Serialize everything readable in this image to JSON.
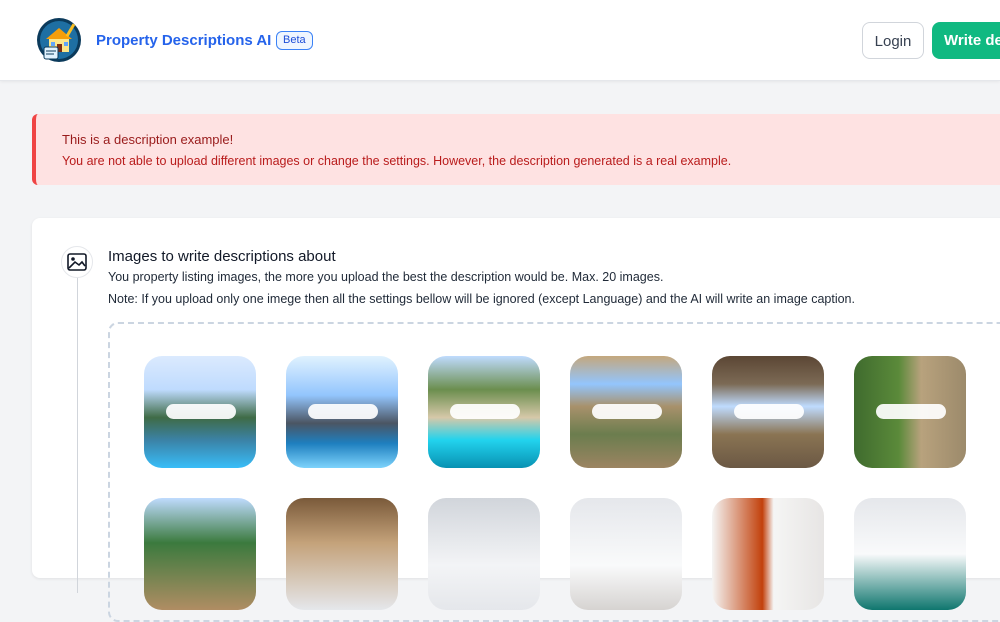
{
  "header": {
    "brand": "Property Descriptions AI",
    "badge": "Beta",
    "login_label": "Login",
    "write_label": "Write de",
    "logo_icon": "house-clipboard-logo-icon"
  },
  "alert": {
    "title": "This is a description example!",
    "text": "You are not able to upload different images or change the settings. However, the description generated is a real example."
  },
  "images_section": {
    "icon": "image-icon",
    "title": "Images to write descriptions about",
    "description": "You property listing images, the more you upload the best the description would be. Max. 20 images.",
    "note": "Note: If you upload only one imege then all the settings bellow will be ignored (except Language) and the AI will write an image caption."
  },
  "colors": {
    "brand": "#2563eb",
    "primary_button": "#10b981",
    "alert_bg": "#fee2e2",
    "alert_border": "#ef4444"
  }
}
